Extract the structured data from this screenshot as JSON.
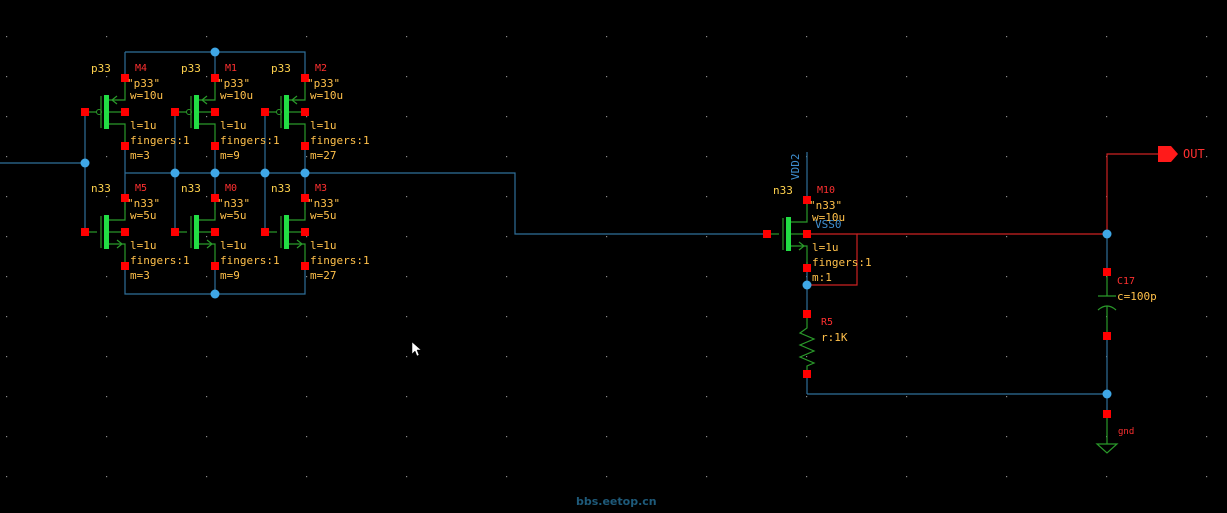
{
  "transistors": [
    {
      "id": "M4",
      "model": "p33",
      "cell": "\"p33\"",
      "w": "w=10u",
      "l": "l=1u",
      "fingers": "fingers:1",
      "m": "m=3"
    },
    {
      "id": "M1",
      "model": "p33",
      "cell": "\"p33\"",
      "w": "w=10u",
      "l": "l=1u",
      "fingers": "fingers:1",
      "m": "m=9"
    },
    {
      "id": "M2",
      "model": "p33",
      "cell": "\"p33\"",
      "w": "w=10u",
      "l": "l=1u",
      "fingers": "fingers:1",
      "m": "m=27"
    },
    {
      "id": "M5",
      "model": "n33",
      "cell": "\"n33\"",
      "w": "w=5u",
      "l": "l=1u",
      "fingers": "fingers:1",
      "m": "m=3"
    },
    {
      "id": "M0",
      "model": "n33",
      "cell": "\"n33\"",
      "w": "w=5u",
      "l": "l=1u",
      "fingers": "fingers:1",
      "m": "m=9"
    },
    {
      "id": "M3",
      "model": "n33",
      "cell": "\"n33\"",
      "w": "w=5u",
      "l": "l=1u",
      "fingers": "fingers:1",
      "m": "m=27"
    },
    {
      "id": "M10",
      "model": "n33",
      "cell": "\"n33\"",
      "w": "w=10u",
      "l": "l=1u",
      "fingers": "fingers:1",
      "m": "m:1"
    }
  ],
  "nets": {
    "vdd": "VDD2",
    "vss": "VSS0"
  },
  "resistor": {
    "id": "R5",
    "value": "r:1K"
  },
  "capacitor": {
    "id": "C17",
    "value": "c=100p"
  },
  "output": {
    "label": "OUT"
  },
  "ground": {
    "label": "gnd"
  },
  "watermark": "bbs.eetop.cn",
  "colors": {
    "wire": "#2f6f99",
    "pin": "#ff0000",
    "body": "#22dd44",
    "label": "#ffc04a",
    "instance": "#ff3030"
  }
}
